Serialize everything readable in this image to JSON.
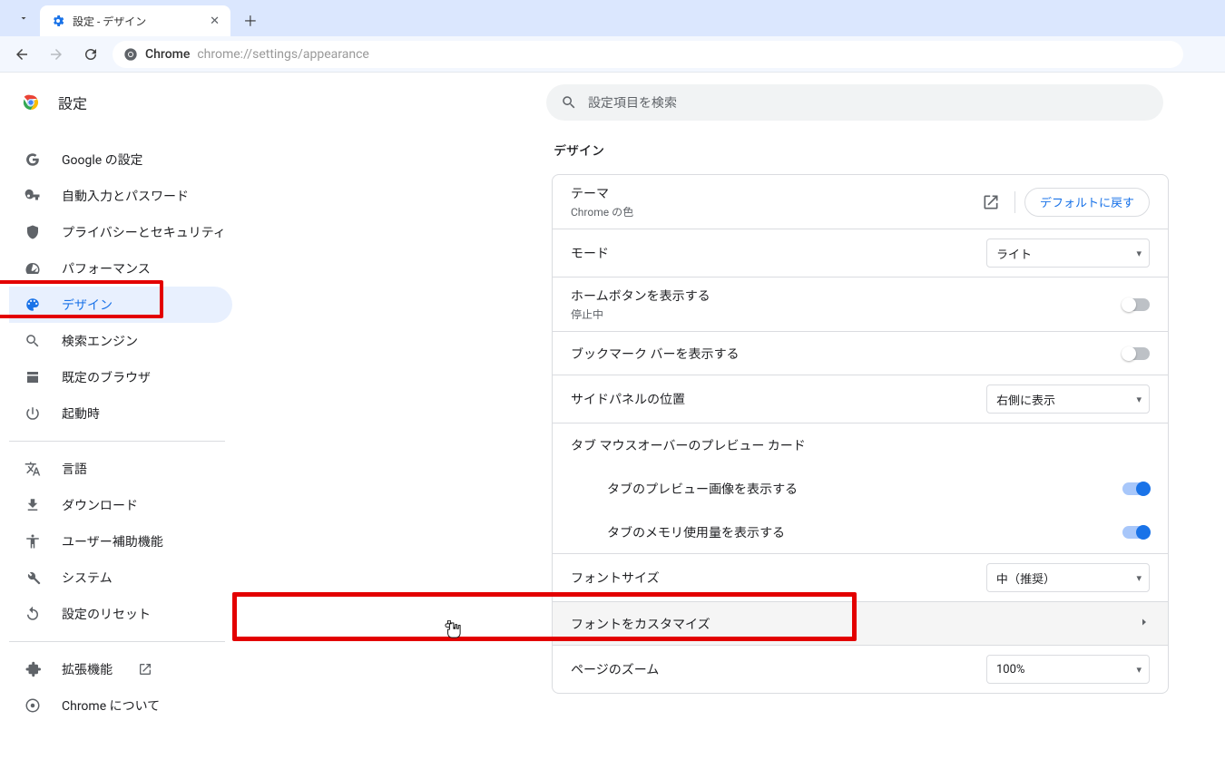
{
  "browser": {
    "tab_title": "設定 - デザイン",
    "secure_label": "Chrome",
    "url": "chrome://settings/appearance"
  },
  "header": {
    "title": "設定",
    "search_placeholder": "設定項目を検索"
  },
  "sidebar": {
    "items": [
      {
        "label": "Google の設定"
      },
      {
        "label": "自動入力とパスワード"
      },
      {
        "label": "プライバシーとセキュリティ"
      },
      {
        "label": "パフォーマンス"
      },
      {
        "label": "デザイン"
      },
      {
        "label": "検索エンジン"
      },
      {
        "label": "既定のブラウザ"
      },
      {
        "label": "起動時"
      }
    ],
    "group2": [
      {
        "label": "言語"
      },
      {
        "label": "ダウンロード"
      },
      {
        "label": "ユーザー補助機能"
      },
      {
        "label": "システム"
      },
      {
        "label": "設定のリセット"
      }
    ],
    "group3": [
      {
        "label": "拡張機能"
      },
      {
        "label": "Chrome について"
      }
    ]
  },
  "main": {
    "section_title": "デザイン",
    "theme": {
      "title": "テーマ",
      "sub": "Chrome の色",
      "reset": "デフォルトに戻す"
    },
    "mode": {
      "title": "モード",
      "value": "ライト"
    },
    "home_button": {
      "title": "ホームボタンを表示する",
      "sub": "停止中"
    },
    "bookmarks_bar": {
      "title": "ブックマーク バーを表示する"
    },
    "side_panel": {
      "title": "サイドパネルの位置",
      "value": "右側に表示"
    },
    "tab_hover": {
      "title": "タブ マウスオーバーのプレビュー カード"
    },
    "tab_preview": {
      "title": "タブのプレビュー画像を表示する"
    },
    "tab_memory": {
      "title": "タブのメモリ使用量を表示する"
    },
    "font_size": {
      "title": "フォントサイズ",
      "value": "中（推奨）"
    },
    "customize_fonts": {
      "title": "フォントをカスタマイズ"
    },
    "page_zoom": {
      "title": "ページのズーム",
      "value": "100%"
    }
  }
}
